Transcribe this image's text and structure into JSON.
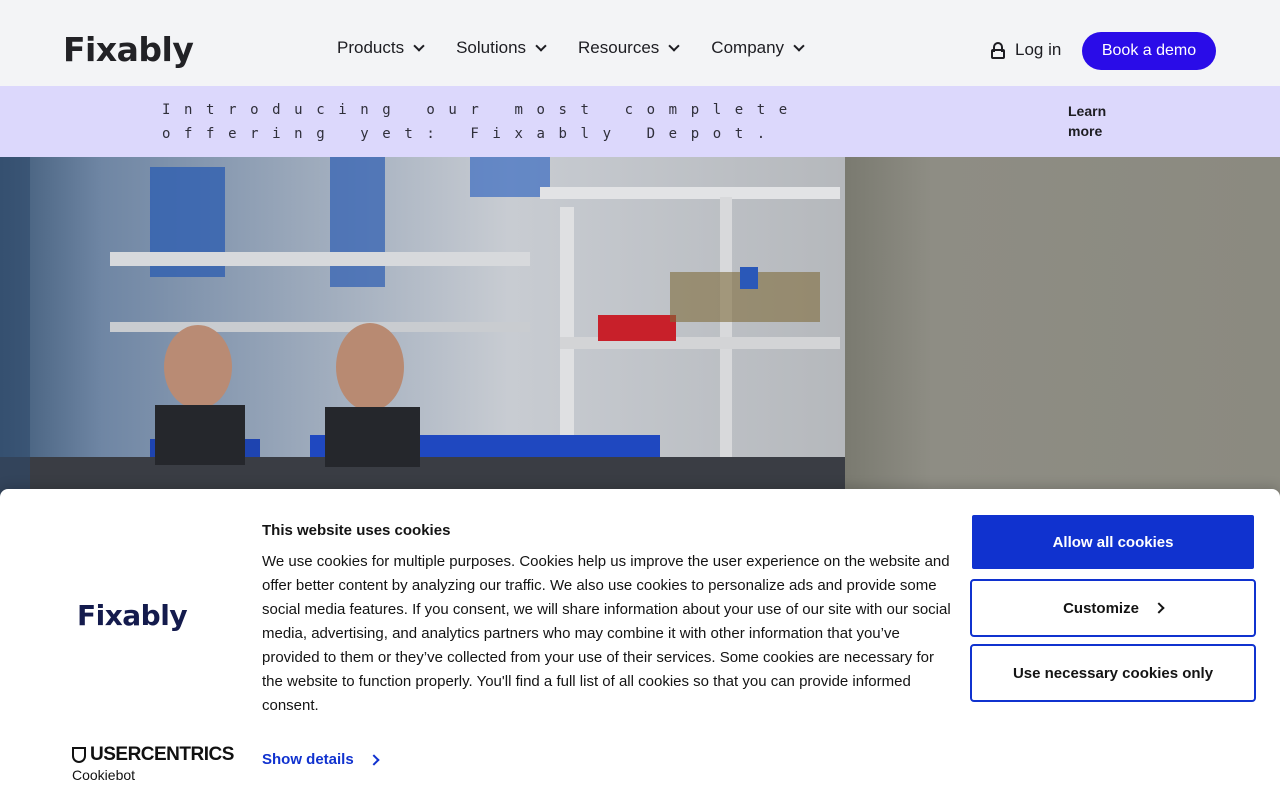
{
  "header": {
    "logo": "Fixably",
    "nav": [
      {
        "label": "Products"
      },
      {
        "label": "Solutions"
      },
      {
        "label": "Resources"
      },
      {
        "label": "Company"
      }
    ],
    "login_label": "Log in",
    "demo_label": "Book a demo"
  },
  "announcement": {
    "text": "Introducing our most complete offering yet: Fixably Depot.",
    "link": "Learn more"
  },
  "cookie_banner": {
    "logo": "Fixably",
    "provider_name": "USERCENTRICS",
    "provider_sub": "Cookiebot",
    "title": "This website uses cookies",
    "body": "We use cookies for multiple purposes. Cookies help us improve the user experience on the website and offer better content by analyzing our traffic. We also use cookies to personalize ads and provide some social media features. If you consent, we will share information about your use of our site with our social media, advertising, and analytics partners who may combine it with other information that you’ve provided to them or they’ve collected from your use of their services. Some cookies are necessary for the website to function properly. You'll find a full list of all cookies so that you can provide informed consent.",
    "show_details": "Show details",
    "allow_all": "Allow all cookies",
    "customize": "Customize",
    "necessary_only": "Use necessary cookies only"
  },
  "colors": {
    "accent": "#2a0ce8",
    "banner_bg": "#dcd8fc",
    "cookie_primary": "#1032cf"
  }
}
